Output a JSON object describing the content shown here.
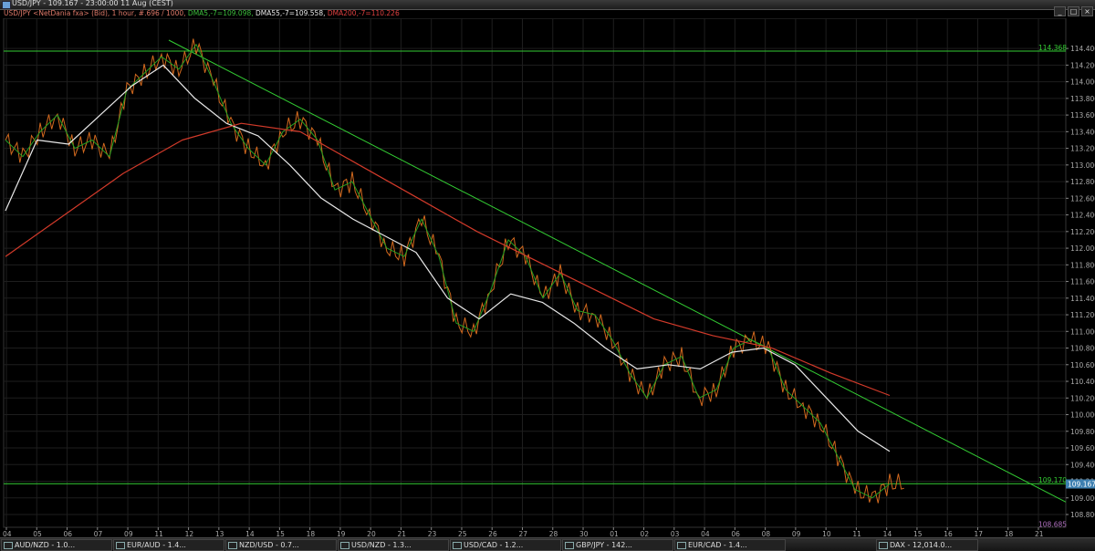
{
  "window": {
    "title": "USD/JPY - 109.167 - 23:00:00  11 Aug (CEST)",
    "buttons": [
      "_",
      "□",
      "×"
    ]
  },
  "legend": {
    "instrument": "USD/JPY <NetDania fxa> (Bid), 1 hour, #.696 / 1000,",
    "dma5": "DMA5,-7=109.098,",
    "dma55": "DMA55,-7=109.558,",
    "dma200": "DMA200,-7=110.226"
  },
  "chart_data": {
    "type": "line",
    "ylim": [
      108.8,
      114.5
    ],
    "y_ticks": [
      "114.400",
      "114.200",
      "114.000",
      "113.800",
      "113.600",
      "113.400",
      "113.200",
      "113.000",
      "112.800",
      "112.600",
      "112.400",
      "112.200",
      "112.000",
      "111.800",
      "111.600",
      "111.400",
      "111.200",
      "111.000",
      "110.800",
      "110.600",
      "110.400",
      "110.200",
      "110.000",
      "109.800",
      "109.600",
      "109.400",
      "109.200",
      "109.000",
      "108.800"
    ],
    "x_ticks": [
      "04",
      "05",
      "06",
      "07",
      "09",
      "11",
      "12",
      "13",
      "14",
      "15",
      "18",
      "19",
      "20",
      "21",
      "23",
      "25",
      "26",
      "27",
      "28",
      "30",
      "01",
      "02",
      "03",
      "04",
      "06",
      "08",
      "09",
      "10",
      "11",
      "14",
      "15",
      "16",
      "17",
      "18",
      "21"
    ],
    "price_points": [
      113.3,
      113.1,
      113.4,
      113.6,
      113.2,
      113.3,
      113.1,
      113.9,
      114.1,
      114.3,
      114.15,
      114.45,
      114.0,
      113.5,
      113.2,
      113.0,
      113.4,
      113.55,
      113.3,
      112.7,
      112.8,
      112.4,
      112.0,
      111.9,
      112.35,
      111.9,
      111.1,
      111.0,
      111.5,
      112.1,
      111.9,
      111.4,
      111.7,
      111.25,
      111.2,
      110.9,
      110.5,
      110.2,
      110.6,
      110.7,
      110.2,
      110.3,
      110.8,
      110.9,
      110.8,
      110.3,
      110.1,
      109.9,
      109.5,
      109.1,
      109.0,
      109.17
    ],
    "dma55_points": [
      112.45,
      113.3,
      113.25,
      113.6,
      113.95,
      114.2,
      113.8,
      113.5,
      113.35,
      113.0,
      112.6,
      112.35,
      112.15,
      111.95,
      111.4,
      111.15,
      111.45,
      111.35,
      111.1,
      110.8,
      110.55,
      110.6,
      110.55,
      110.75,
      110.8,
      110.6,
      110.2,
      109.8,
      109.56
    ],
    "dma200_points": [
      111.9,
      112.4,
      112.9,
      113.3,
      113.5,
      113.4,
      113.0,
      112.6,
      112.2,
      111.85,
      111.5,
      111.15,
      110.95,
      110.8,
      110.5,
      110.23
    ],
    "levels": [
      {
        "value": 114.368,
        "label": "114.368"
      },
      {
        "value": 109.17,
        "label": "109.170"
      }
    ],
    "current_price": "109.167",
    "low_marker": "108.685",
    "trendlines": [
      {
        "name": "downtrend-upper",
        "from": [
          114.5
        ],
        "to": [
          108.95
        ]
      }
    ],
    "colors": {
      "price": "#d2691e",
      "dma5": "#22a022",
      "dma55": "#e8e8e8",
      "dma200": "#d23a2a",
      "levels": "#33cc33",
      "grid": "#1e1e1e",
      "current_price_bg": "#3d7fb0",
      "low_marker": "#b070c0"
    }
  },
  "taskbar": [
    {
      "label": "AUD/NZD - 1.0..."
    },
    {
      "label": "EUR/AUD - 1.4..."
    },
    {
      "label": "NZD/USD - 0.7..."
    },
    {
      "label": "USD/NZD - 1.3..."
    },
    {
      "label": "USD/CAD - 1.2..."
    },
    {
      "label": "GBP/JPY - 142..."
    },
    {
      "label": "EUR/CAD - 1.4..."
    },
    {
      "label": "DAX - 12,014.0..."
    }
  ]
}
